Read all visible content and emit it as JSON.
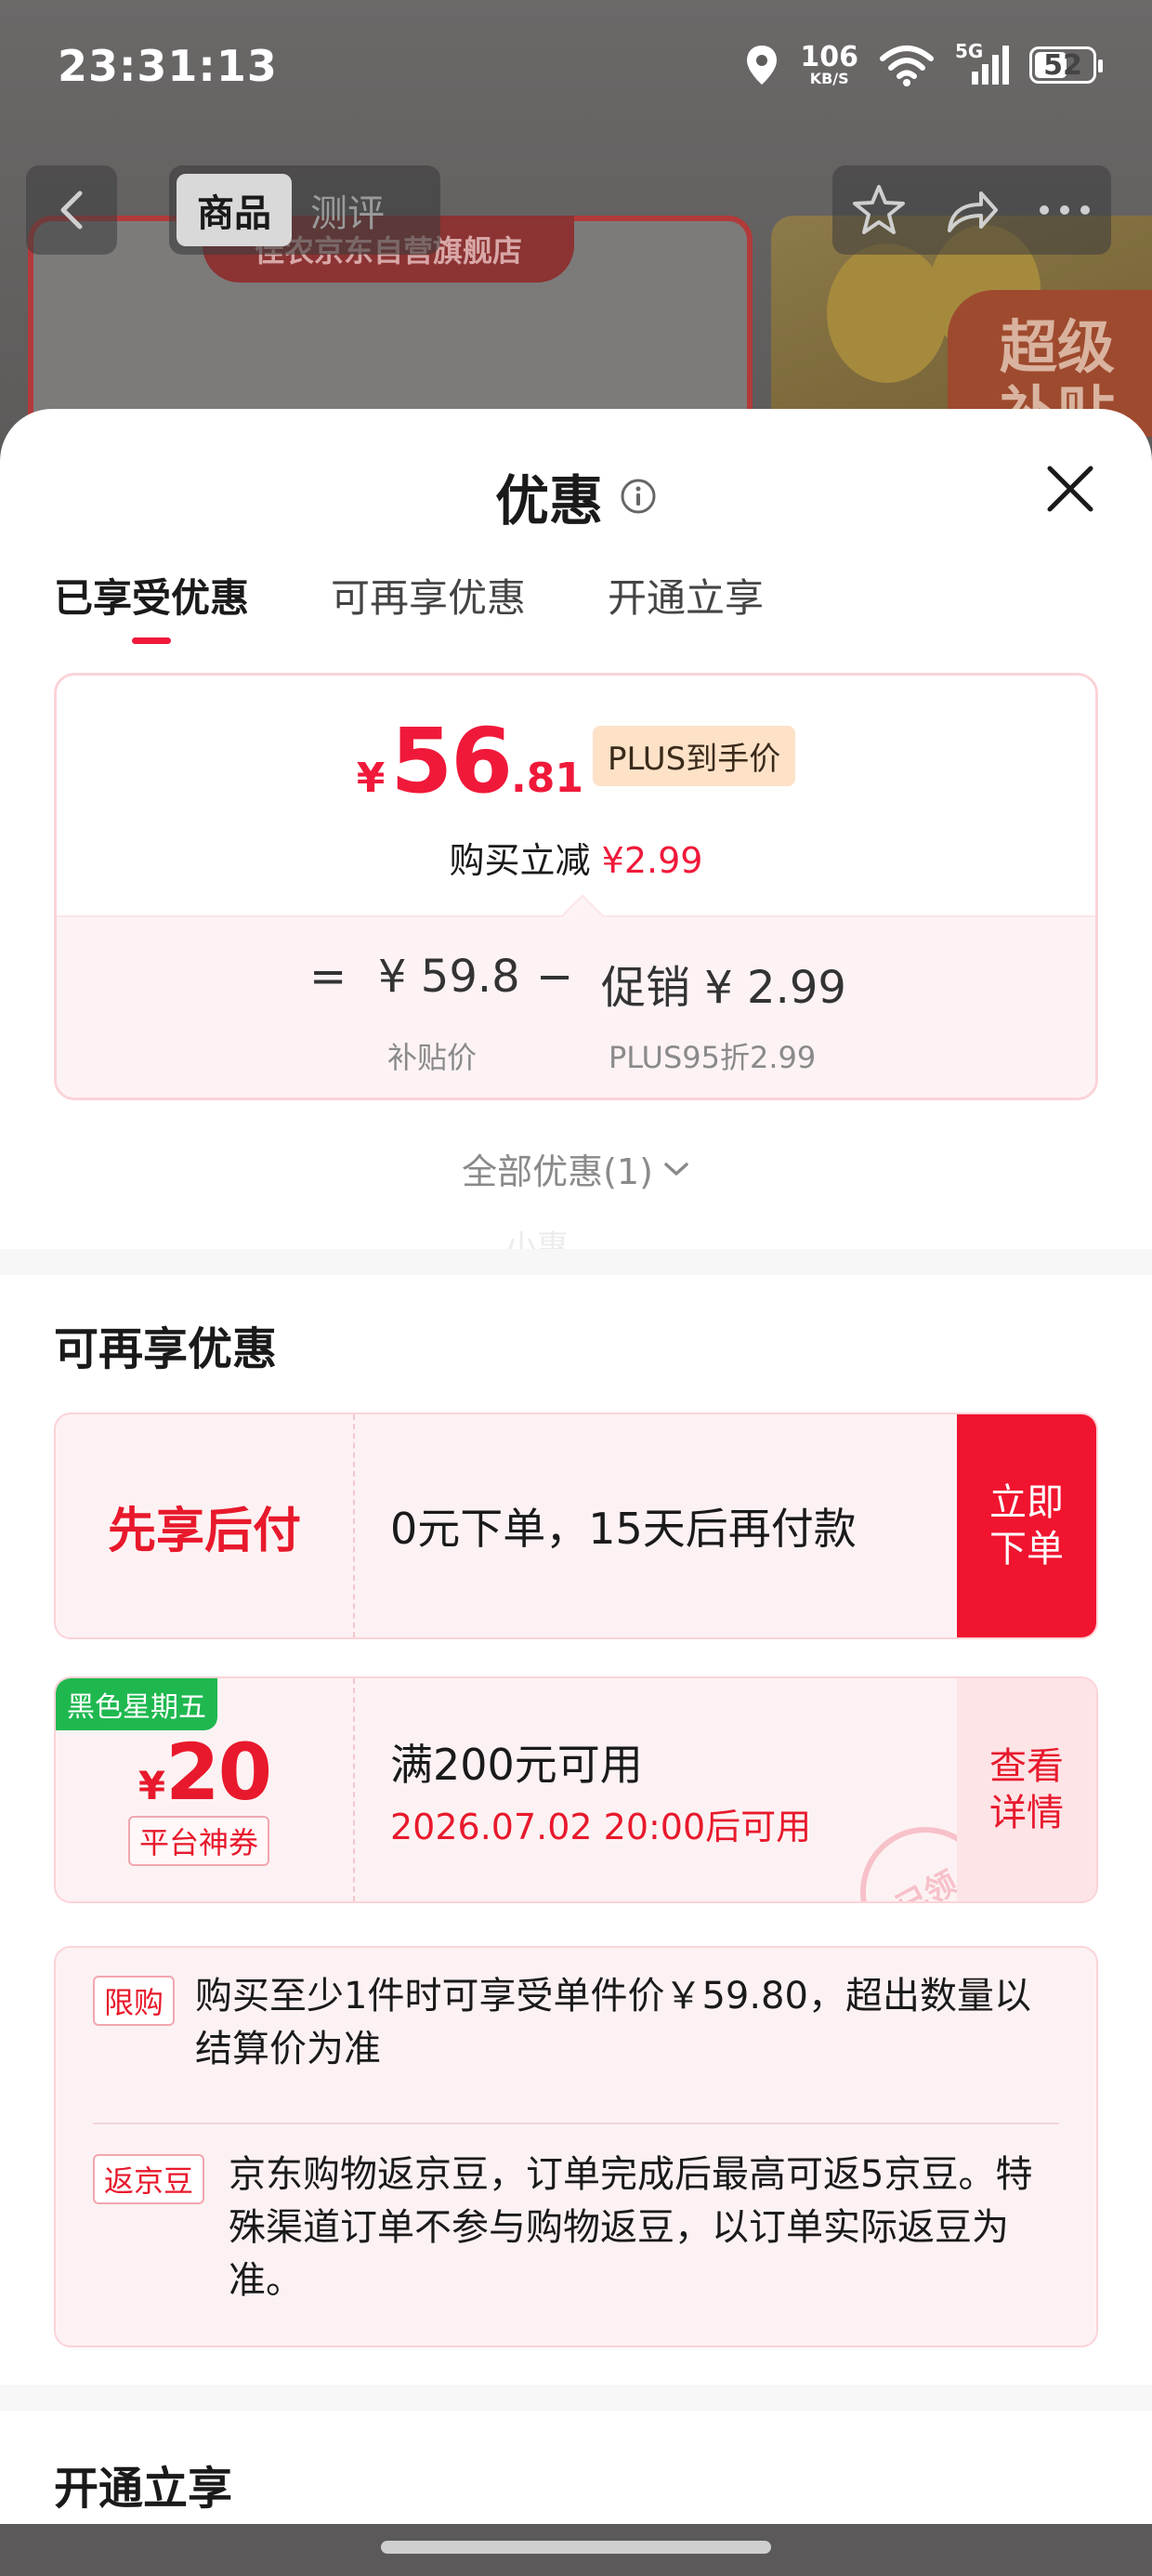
{
  "status_bar": {
    "time": "23:31:13",
    "net_speed_value": "106",
    "net_speed_unit": "KB/S",
    "cell_label": "5G",
    "battery": "52",
    "icons": [
      "location-icon",
      "wifi-icon",
      "cellular-signal-icon",
      "battery-icon"
    ]
  },
  "product_page": {
    "tabs": [
      "商品",
      "测评"
    ],
    "store_banner": "佳农京东自营旗舰店",
    "promo_badge": "超级补贴",
    "icons": [
      "back-arrow-icon",
      "star-icon",
      "share-icon",
      "more-icon"
    ]
  },
  "sheet": {
    "title": "优惠",
    "tabs": [
      {
        "label": "已享受优惠",
        "active": true
      },
      {
        "label": "可再享优惠",
        "active": false
      },
      {
        "label": "开通立享",
        "active": false
      }
    ],
    "price_card": {
      "currency": "¥",
      "price_int": "56",
      "price_dec": ".81",
      "plus_tag": "PLUS到手价",
      "reduction_label": "购买立减",
      "reduction_value": "¥2.99",
      "equals": "=",
      "base_value": "¥ 59.8",
      "base_label": "补贴价",
      "minus": "−",
      "promo_value": "促销 ¥ 2.99",
      "promo_label": "PLUS95折2.99"
    },
    "all_offers": "全部优惠(1)",
    "watermark": "小惠",
    "more_section": {
      "title": "可再享优惠",
      "bnpl": {
        "label": "先享后付",
        "text": "0元下单，15天后再付款",
        "action": "立即下单"
      },
      "coupon": {
        "tag": "黑色星期五",
        "currency": "¥",
        "amount": "20",
        "type": "平台神券",
        "condition": "满200元可用",
        "valid_from": "2026.07.02 20:00后可用",
        "action": "查看详情",
        "stamp": "已领"
      },
      "rules": [
        {
          "badge": "限购",
          "text": "购买至少1件时可享受单件价￥59.80，超出数量以结算价为准"
        },
        {
          "badge": "返京豆",
          "text": "京东购物返京豆，订单完成后最高可返5京豆。特殊渠道订单不参与购物返豆，以订单实际返豆为准。"
        }
      ]
    },
    "open_section": {
      "title": "开通立享"
    }
  },
  "colors": {
    "accent_red": "#f0193a",
    "tag_green": "#1fb84f",
    "plus_tag_bg": "#fde2c8"
  }
}
